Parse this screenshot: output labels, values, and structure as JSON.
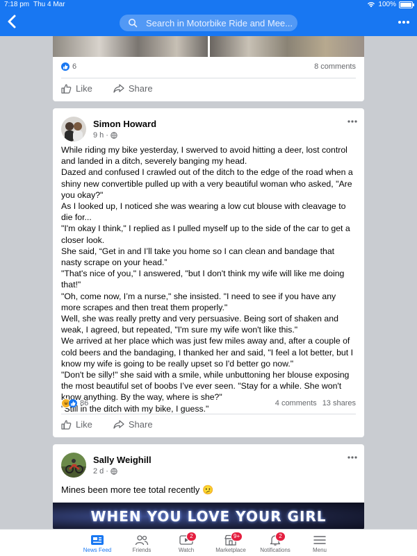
{
  "status_bar": {
    "time": "7:18 pm",
    "date": "Thu 4 Mar",
    "battery": "100%"
  },
  "header": {
    "search_placeholder": "Search in Motorbike Ride and Mee..."
  },
  "post1": {
    "reaction_count": "6",
    "comments": "8 comments",
    "like_label": "Like",
    "share_label": "Share"
  },
  "post2": {
    "author": "Simon Howard",
    "time": "9 h",
    "lines": [
      "While riding my bike yesterday, I swerved to avoid hitting a deer, lost control and landed in a ditch, severely banging my head.",
      "Dazed and confused I crawled out of the ditch to the edge of the road when a shiny new convertible pulled up with a very beautiful woman who asked, \"Are you okay?\"",
      "As I looked up, I noticed she was wearing a low cut blouse with cleavage to die for...",
      "\"I'm okay I think,\" I replied as I pulled myself up to the side of the car to get a closer look.",
      "She said, “Get in and I’ll take you home so I can clean and bandage that nasty scrape on your head.”",
      "\"That's nice of you,\" I answered, \"but I don't think my wife will like me doing that!\"",
      "\"Oh, come now, I’m a nurse,\" she insisted. \"I need to see if you have any more scrapes and then treat them properly.\"",
      "Well, she was really pretty and very persuasive. Being sort of shaken and weak, I agreed, but repeated, \"I'm sure my wife won't like this.\"",
      "We arrived at her place which was just few miles away and, after a couple of cold beers and the bandaging, I thanked her and said, \"I feel a lot better, but I know my wife is going to be really upset so I'd better go now.\"",
      "\"Don't be silly!\" she said with a smile, while unbuttoning her blouse exposing the most beautiful set of boobs I’ve ever seen. \"Stay for a while. She won't know anything. By the way, where is she?\"",
      "\"Still in the ditch with my bike, I guess.\""
    ],
    "reaction_count": "86",
    "comments": "4 comments",
    "shares": "13 shares",
    "like_label": "Like",
    "share_label": "Share"
  },
  "post3": {
    "author": "Sally Weighill",
    "time": "2 d",
    "text": "Mines been more tee total recently 🫤",
    "image_caption": "WHEN YOU LOVE YOUR GIRL"
  },
  "tabbar": {
    "tabs": [
      {
        "label": "News Feed",
        "badge": ""
      },
      {
        "label": "Friends",
        "badge": ""
      },
      {
        "label": "Watch",
        "badge": "2"
      },
      {
        "label": "Marketplace",
        "badge": "9+"
      },
      {
        "label": "Notifications",
        "badge": "2"
      },
      {
        "label": "Menu",
        "badge": ""
      }
    ]
  },
  "colors": {
    "brand": "#1877f2",
    "badge": "#e41e3f",
    "muted": "#65676b"
  }
}
